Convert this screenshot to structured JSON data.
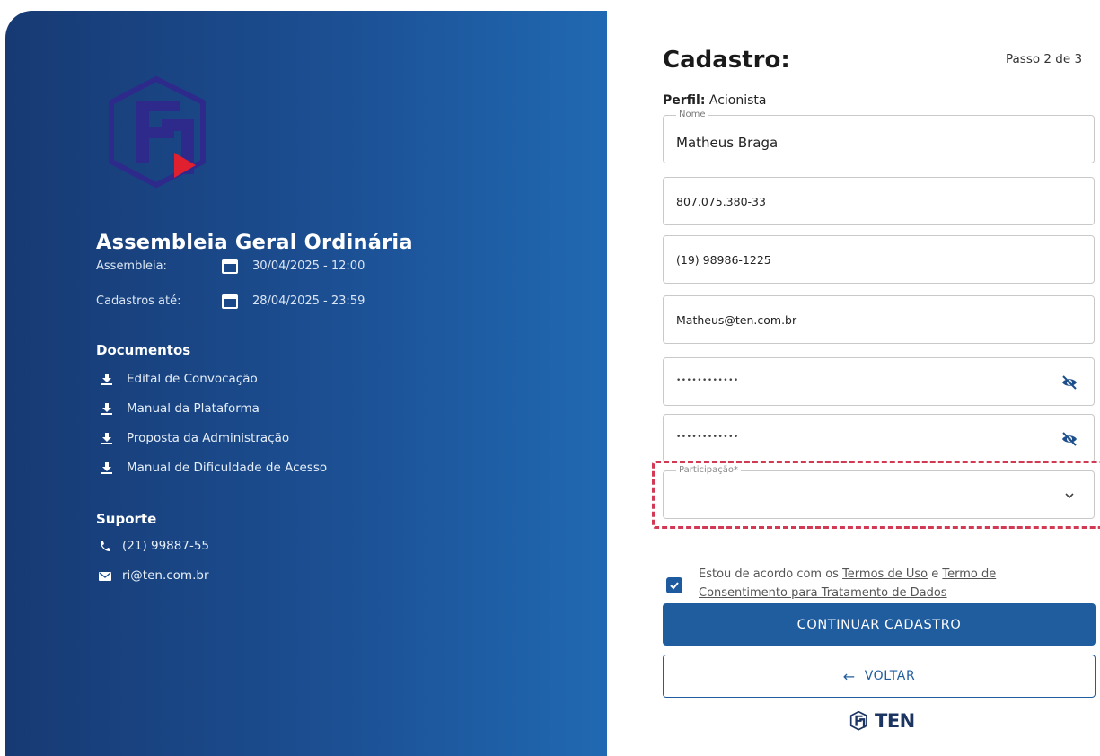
{
  "event": {
    "title": "Assembleia Geral Ordinária",
    "assembly_label": "Assembleia:",
    "assembly_date": "30/04/2025 - 12:00",
    "registration_label": "Cadastros até:",
    "registration_date": "28/04/2025 - 23:59"
  },
  "documents": {
    "title": "Documentos",
    "items": [
      {
        "label": "Edital de Convocação",
        "icon": "download-icon"
      },
      {
        "label": "Manual da Plataforma",
        "icon": "download-icon"
      },
      {
        "label": "Proposta da Administração",
        "icon": "download-icon"
      },
      {
        "label": "Manual de Dificuldade de Acesso",
        "icon": "download-icon"
      }
    ]
  },
  "support": {
    "title": "Suporte",
    "phone": "(21) 99887-55",
    "email": "ri@ten.com.br"
  },
  "form": {
    "title": "Cadastro:",
    "step": "Passo 2 de 3",
    "profile_label": "Perfil:",
    "profile_value": "Acionista",
    "name_label": "Nome",
    "name_value": "Matheus Braga",
    "cpf_value": "807.075.380-33",
    "phone_value": "(19) 98986-1225",
    "email_value": "Matheus@ten.com.br",
    "password_value": "••••••••••••",
    "password_confirm_value": "••••••••••••",
    "participation_label": "Participação*",
    "participation_value": "",
    "terms_checked": true,
    "terms_prefix": "Estou de acordo com os ",
    "terms_link1": "Termos de Uso",
    "terms_mid": " e ",
    "terms_link2": "Termo de Consentimento para Tratamento de Dados",
    "continue_label": "CONTINUAR CADASTRO",
    "back_label": "VOLTAR"
  },
  "brand": {
    "name": "TEN",
    "primary_color": "#1f5d9f",
    "accent_color": "#e0202e",
    "highlight_color": "#d23a53"
  }
}
